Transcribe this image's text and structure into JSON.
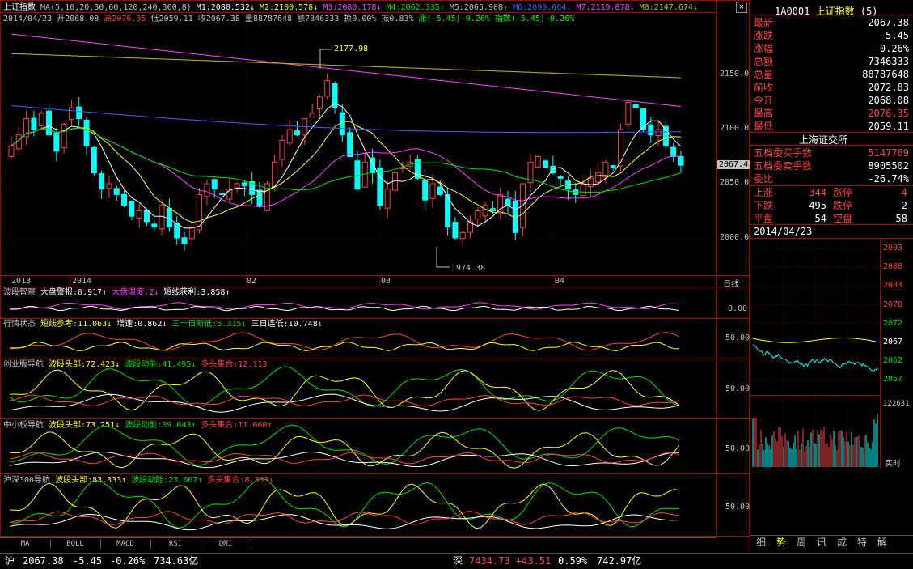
{
  "header": {
    "index_name": "上证指数",
    "ma_params": "MA(5,10,20,30,60,120,240,360,8)",
    "ma_values": [
      {
        "label": "M1:2080.532",
        "arrow": "↓",
        "color": "#ffffff"
      },
      {
        "label": "M2:2100.578",
        "arrow": "↓",
        "color": "#ffff00"
      },
      {
        "label": "M3:2080.178",
        "arrow": "↓",
        "color": "#ff40ff"
      },
      {
        "label": "M4:2062.335",
        "arrow": "↑",
        "color": "#00e000"
      },
      {
        "label": "M5:2065.908",
        "arrow": "↑",
        "color": "#c0c0c0"
      },
      {
        "label": "M6:2099.664",
        "arrow": "↓",
        "color": "#4060ff"
      },
      {
        "label": "M7:2119.878",
        "arrow": "↓",
        "color": "#ff40ff"
      },
      {
        "label": "M8:2147.674",
        "arrow": "↓",
        "color": "#c0c000"
      }
    ],
    "line2": [
      {
        "t": "2014/04/23",
        "c": "#c0c0c0"
      },
      {
        "t": "开2068.08",
        "c": "#c0c0c0"
      },
      {
        "t": "高2076.35",
        "c": "#ff4040"
      },
      {
        "t": "低2059.11",
        "c": "#c0c0c0"
      },
      {
        "t": "收2067.38",
        "c": "#c0c0c0"
      },
      {
        "t": "量88787648",
        "c": "#c0c0c0"
      },
      {
        "t": "额7346333",
        "c": "#c0c0c0"
      },
      {
        "t": "换0.00%",
        "c": "#c0c0c0"
      },
      {
        "t": "振0.83%",
        "c": "#c0c0c0"
      },
      {
        "t": "涨(-5.45)-0.26%",
        "c": "#00ff00"
      },
      {
        "t": "指数(-5.45)-0.26%",
        "c": "#00ff00"
      }
    ]
  },
  "main_chart": {
    "y_ticks": [
      "2150.0",
      "2100.0",
      "2050.0",
      "2000.0"
    ],
    "current_price_tag": "2067.4",
    "high_annotation": "2177.98",
    "low_annotation": "1974.38",
    "x_labels": [
      "2013",
      "2014",
      "02",
      "03",
      "04"
    ],
    "period_label": "日线"
  },
  "indicators": [
    {
      "name": "波段智察",
      "items": [
        {
          "t": "大盘警报:0.917",
          "a": "↑",
          "c": "#ffffff"
        },
        {
          "t": "大盘温度:2",
          "a": "↓",
          "c": "#ff40ff"
        },
        {
          "t": "短线获利:3.858",
          "a": "↑",
          "c": "#ffffff"
        }
      ],
      "tick": "0.00"
    },
    {
      "name": "行情状态",
      "items": [
        {
          "t": "短线参考:11.063",
          "a": "↓",
          "c": "#ffff00"
        },
        {
          "t": "增速:0.862",
          "a": "↓",
          "c": "#ffffff"
        },
        {
          "t": "三十日新低:5.315",
          "a": "↓",
          "c": "#00e000"
        },
        {
          "t": "三日连低:10.748",
          "a": "↓",
          "c": "#ffffff"
        }
      ],
      "tick": "50.00"
    },
    {
      "name": "创业版导航",
      "items": [
        {
          "t": "波段头部:72.423",
          "a": "↓",
          "c": "#ffff00"
        },
        {
          "t": "波段动能:41.495",
          "a": "↓",
          "c": "#00e000"
        },
        {
          "t": "多头集合:12.113",
          "a": "",
          "c": "#ff4040"
        }
      ],
      "tick": "50.00"
    },
    {
      "name": "中小板导航",
      "items": [
        {
          "t": "波段头部:73.251",
          "a": "↓",
          "c": "#ffff00"
        },
        {
          "t": "波段动能:39.643",
          "a": "↑",
          "c": "#00e000"
        },
        {
          "t": "多头集合:11.660",
          "a": "↑",
          "c": "#ff4040"
        }
      ],
      "tick": "50.00"
    },
    {
      "name": "沪深300导航",
      "items": [
        {
          "t": "波段头部:83.333",
          "a": "↑",
          "c": "#ffff00"
        },
        {
          "t": "波段动能:23.667",
          "a": "↑",
          "c": "#00e000"
        },
        {
          "t": "多头集合:8.333",
          "a": "↓",
          "c": "#ff4040"
        }
      ],
      "tick": "50.00"
    }
  ],
  "bottom_tabs": [
    "MA",
    "BOLL",
    "MACD",
    "RSI",
    "DMI"
  ],
  "quote_panel": {
    "code": "1A0001",
    "name": "上证指数",
    "count": "(5)",
    "rows": [
      {
        "label": "最新",
        "value": "2067.38",
        "color": "#ffffff"
      },
      {
        "label": "涨跌",
        "value": "-5.45",
        "color": "#ffffff"
      },
      {
        "label": "涨幅",
        "value": "-0.26%",
        "color": "#ffffff"
      },
      {
        "label": "总额",
        "value": "7346333",
        "color": "#ffffff"
      },
      {
        "label": "总量",
        "value": "88787648",
        "color": "#ffffff"
      },
      {
        "label": "前收",
        "value": "2072.83",
        "color": "#ffffff"
      },
      {
        "label": "今开",
        "value": "2068.08",
        "color": "#ffffff"
      },
      {
        "label": "最高",
        "value": "2076.35",
        "color": "#ff4040"
      },
      {
        "label": "最低",
        "value": "2059.11",
        "color": "#ffffff"
      }
    ],
    "exchange": "上海证交所",
    "depth": [
      {
        "label": "五档委买手数",
        "value": "5147769",
        "color": "#ff4040"
      },
      {
        "label": "五档委卖手数",
        "value": "8905502",
        "color": "#ffffff"
      },
      {
        "label": "委比",
        "value": "-26.74%",
        "color": "#ffffff"
      }
    ],
    "breadth": [
      {
        "l1": "上涨",
        "v1": "344",
        "c1": "#ff4040",
        "l2": "涨停",
        "v2": "4",
        "c2": "#ff4040"
      },
      {
        "l1": "下跌",
        "v1": "495",
        "c1": "#ffffff",
        "l2": "跌停",
        "v2": "2",
        "c2": "#ffffff"
      },
      {
        "l1": "平盘",
        "v1": "54",
        "c1": "#ffffff",
        "l2": "空盘",
        "v2": "58",
        "c2": "#ffffff"
      }
    ],
    "date": "2014/04/23",
    "mini_ticks": [
      "2093",
      "2088",
      "2083",
      "2078",
      "2072",
      "2067",
      "2062",
      "2057"
    ],
    "vol_tick": "122631",
    "realtime_label": "实时",
    "tabs": [
      "细",
      "势",
      "周",
      "讯",
      "成",
      "特",
      "解"
    ]
  },
  "status_bar": {
    "sh_label": "沪",
    "sh_price": "2067.38",
    "sh_change": "-5.45",
    "sh_pct": "-0.26%",
    "sh_amount": "734.63亿",
    "sz_label": "深",
    "sz_price": "7434.73",
    "sz_change": "+43.51",
    "sz_pct": "0.59%",
    "sz_amount": "742.97亿"
  },
  "colors": {
    "up": "#ff4040",
    "down": "#00ffff",
    "border": "#a00000",
    "ma5": "#ffffff",
    "ma10": "#ffff00",
    "ma20": "#ff40ff",
    "ma30": "#00e000",
    "ma120": "#4060ff",
    "ma240": "#ff40ff",
    "ma360": "#c0c000"
  }
}
